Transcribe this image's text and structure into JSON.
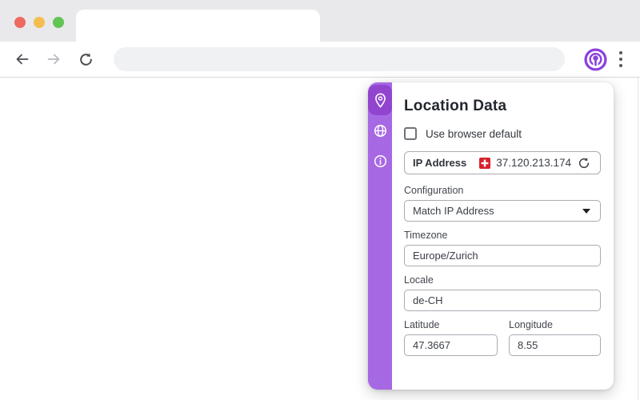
{
  "colors": {
    "accent_purple": "#8b42dd",
    "sidebar_purple": "#a768e4",
    "sidebar_selected_purple": "#9145cf",
    "flag_red": "#d8222a",
    "traffic_red": "#ee6a5f",
    "traffic_yellow": "#f5bd4f",
    "traffic_green": "#61c554"
  },
  "browser": {
    "address_bar": {
      "value": ""
    },
    "icons": [
      "back-arrow",
      "forward-arrow",
      "reload",
      "privacy-extension",
      "kebab-menu"
    ]
  },
  "popup": {
    "title": "Location Data",
    "sidebar": {
      "items": [
        {
          "icon": "location-pin",
          "selected": true
        },
        {
          "icon": "globe",
          "selected": false
        },
        {
          "icon": "info",
          "selected": false
        }
      ]
    },
    "use_browser_default": {
      "label": "Use browser default",
      "checked": false
    },
    "ip": {
      "label": "IP Address",
      "value": "37.120.213.174",
      "flag": "switzerland-flag",
      "refresh_icon": "refresh"
    },
    "fields": {
      "configuration": {
        "label": "Configuration",
        "value": "Match IP Address"
      },
      "timezone": {
        "label": "Timezone",
        "value": "Europe/Zurich"
      },
      "locale": {
        "label": "Locale",
        "value": "de-CH"
      },
      "latitude": {
        "label": "Latitude",
        "value": "47.3667"
      },
      "longitude": {
        "label": "Longitude",
        "value": "8.55"
      }
    }
  }
}
